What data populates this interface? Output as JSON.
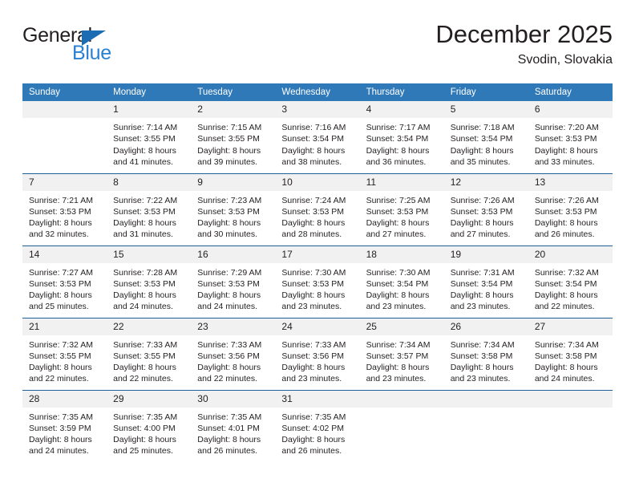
{
  "brand": {
    "name_dark": "General",
    "name_blue": "Blue",
    "accent_blue": "#2980d4",
    "triangle_blue": "#1c6cb3"
  },
  "header": {
    "title": "December 2025",
    "subtitle": "Svodin, Slovakia"
  },
  "theme": {
    "header_bg": "#3079b8",
    "daynum_bg": "#f1f1f1",
    "row_border": "#1f6099",
    "text": "#231f20"
  },
  "weekday_headers": [
    "Sunday",
    "Monday",
    "Tuesday",
    "Wednesday",
    "Thursday",
    "Friday",
    "Saturday"
  ],
  "weeks": [
    [
      {
        "day": "",
        "sunrise": "",
        "sunset": "",
        "daylight_line1": "",
        "daylight_line2": ""
      },
      {
        "day": "1",
        "sunrise": "Sunrise: 7:14 AM",
        "sunset": "Sunset: 3:55 PM",
        "daylight_line1": "Daylight: 8 hours",
        "daylight_line2": "and 41 minutes."
      },
      {
        "day": "2",
        "sunrise": "Sunrise: 7:15 AM",
        "sunset": "Sunset: 3:55 PM",
        "daylight_line1": "Daylight: 8 hours",
        "daylight_line2": "and 39 minutes."
      },
      {
        "day": "3",
        "sunrise": "Sunrise: 7:16 AM",
        "sunset": "Sunset: 3:54 PM",
        "daylight_line1": "Daylight: 8 hours",
        "daylight_line2": "and 38 minutes."
      },
      {
        "day": "4",
        "sunrise": "Sunrise: 7:17 AM",
        "sunset": "Sunset: 3:54 PM",
        "daylight_line1": "Daylight: 8 hours",
        "daylight_line2": "and 36 minutes."
      },
      {
        "day": "5",
        "sunrise": "Sunrise: 7:18 AM",
        "sunset": "Sunset: 3:54 PM",
        "daylight_line1": "Daylight: 8 hours",
        "daylight_line2": "and 35 minutes."
      },
      {
        "day": "6",
        "sunrise": "Sunrise: 7:20 AM",
        "sunset": "Sunset: 3:53 PM",
        "daylight_line1": "Daylight: 8 hours",
        "daylight_line2": "and 33 minutes."
      }
    ],
    [
      {
        "day": "7",
        "sunrise": "Sunrise: 7:21 AM",
        "sunset": "Sunset: 3:53 PM",
        "daylight_line1": "Daylight: 8 hours",
        "daylight_line2": "and 32 minutes."
      },
      {
        "day": "8",
        "sunrise": "Sunrise: 7:22 AM",
        "sunset": "Sunset: 3:53 PM",
        "daylight_line1": "Daylight: 8 hours",
        "daylight_line2": "and 31 minutes."
      },
      {
        "day": "9",
        "sunrise": "Sunrise: 7:23 AM",
        "sunset": "Sunset: 3:53 PM",
        "daylight_line1": "Daylight: 8 hours",
        "daylight_line2": "and 30 minutes."
      },
      {
        "day": "10",
        "sunrise": "Sunrise: 7:24 AM",
        "sunset": "Sunset: 3:53 PM",
        "daylight_line1": "Daylight: 8 hours",
        "daylight_line2": "and 28 minutes."
      },
      {
        "day": "11",
        "sunrise": "Sunrise: 7:25 AM",
        "sunset": "Sunset: 3:53 PM",
        "daylight_line1": "Daylight: 8 hours",
        "daylight_line2": "and 27 minutes."
      },
      {
        "day": "12",
        "sunrise": "Sunrise: 7:26 AM",
        "sunset": "Sunset: 3:53 PM",
        "daylight_line1": "Daylight: 8 hours",
        "daylight_line2": "and 27 minutes."
      },
      {
        "day": "13",
        "sunrise": "Sunrise: 7:26 AM",
        "sunset": "Sunset: 3:53 PM",
        "daylight_line1": "Daylight: 8 hours",
        "daylight_line2": "and 26 minutes."
      }
    ],
    [
      {
        "day": "14",
        "sunrise": "Sunrise: 7:27 AM",
        "sunset": "Sunset: 3:53 PM",
        "daylight_line1": "Daylight: 8 hours",
        "daylight_line2": "and 25 minutes."
      },
      {
        "day": "15",
        "sunrise": "Sunrise: 7:28 AM",
        "sunset": "Sunset: 3:53 PM",
        "daylight_line1": "Daylight: 8 hours",
        "daylight_line2": "and 24 minutes."
      },
      {
        "day": "16",
        "sunrise": "Sunrise: 7:29 AM",
        "sunset": "Sunset: 3:53 PM",
        "daylight_line1": "Daylight: 8 hours",
        "daylight_line2": "and 24 minutes."
      },
      {
        "day": "17",
        "sunrise": "Sunrise: 7:30 AM",
        "sunset": "Sunset: 3:53 PM",
        "daylight_line1": "Daylight: 8 hours",
        "daylight_line2": "and 23 minutes."
      },
      {
        "day": "18",
        "sunrise": "Sunrise: 7:30 AM",
        "sunset": "Sunset: 3:54 PM",
        "daylight_line1": "Daylight: 8 hours",
        "daylight_line2": "and 23 minutes."
      },
      {
        "day": "19",
        "sunrise": "Sunrise: 7:31 AM",
        "sunset": "Sunset: 3:54 PM",
        "daylight_line1": "Daylight: 8 hours",
        "daylight_line2": "and 23 minutes."
      },
      {
        "day": "20",
        "sunrise": "Sunrise: 7:32 AM",
        "sunset": "Sunset: 3:54 PM",
        "daylight_line1": "Daylight: 8 hours",
        "daylight_line2": "and 22 minutes."
      }
    ],
    [
      {
        "day": "21",
        "sunrise": "Sunrise: 7:32 AM",
        "sunset": "Sunset: 3:55 PM",
        "daylight_line1": "Daylight: 8 hours",
        "daylight_line2": "and 22 minutes."
      },
      {
        "day": "22",
        "sunrise": "Sunrise: 7:33 AM",
        "sunset": "Sunset: 3:55 PM",
        "daylight_line1": "Daylight: 8 hours",
        "daylight_line2": "and 22 minutes."
      },
      {
        "day": "23",
        "sunrise": "Sunrise: 7:33 AM",
        "sunset": "Sunset: 3:56 PM",
        "daylight_line1": "Daylight: 8 hours",
        "daylight_line2": "and 22 minutes."
      },
      {
        "day": "24",
        "sunrise": "Sunrise: 7:33 AM",
        "sunset": "Sunset: 3:56 PM",
        "daylight_line1": "Daylight: 8 hours",
        "daylight_line2": "and 23 minutes."
      },
      {
        "day": "25",
        "sunrise": "Sunrise: 7:34 AM",
        "sunset": "Sunset: 3:57 PM",
        "daylight_line1": "Daylight: 8 hours",
        "daylight_line2": "and 23 minutes."
      },
      {
        "day": "26",
        "sunrise": "Sunrise: 7:34 AM",
        "sunset": "Sunset: 3:58 PM",
        "daylight_line1": "Daylight: 8 hours",
        "daylight_line2": "and 23 minutes."
      },
      {
        "day": "27",
        "sunrise": "Sunrise: 7:34 AM",
        "sunset": "Sunset: 3:58 PM",
        "daylight_line1": "Daylight: 8 hours",
        "daylight_line2": "and 24 minutes."
      }
    ],
    [
      {
        "day": "28",
        "sunrise": "Sunrise: 7:35 AM",
        "sunset": "Sunset: 3:59 PM",
        "daylight_line1": "Daylight: 8 hours",
        "daylight_line2": "and 24 minutes."
      },
      {
        "day": "29",
        "sunrise": "Sunrise: 7:35 AM",
        "sunset": "Sunset: 4:00 PM",
        "daylight_line1": "Daylight: 8 hours",
        "daylight_line2": "and 25 minutes."
      },
      {
        "day": "30",
        "sunrise": "Sunrise: 7:35 AM",
        "sunset": "Sunset: 4:01 PM",
        "daylight_line1": "Daylight: 8 hours",
        "daylight_line2": "and 26 minutes."
      },
      {
        "day": "31",
        "sunrise": "Sunrise: 7:35 AM",
        "sunset": "Sunset: 4:02 PM",
        "daylight_line1": "Daylight: 8 hours",
        "daylight_line2": "and 26 minutes."
      },
      {
        "day": "",
        "sunrise": "",
        "sunset": "",
        "daylight_line1": "",
        "daylight_line2": ""
      },
      {
        "day": "",
        "sunrise": "",
        "sunset": "",
        "daylight_line1": "",
        "daylight_line2": ""
      },
      {
        "day": "",
        "sunrise": "",
        "sunset": "",
        "daylight_line1": "",
        "daylight_line2": ""
      }
    ]
  ]
}
